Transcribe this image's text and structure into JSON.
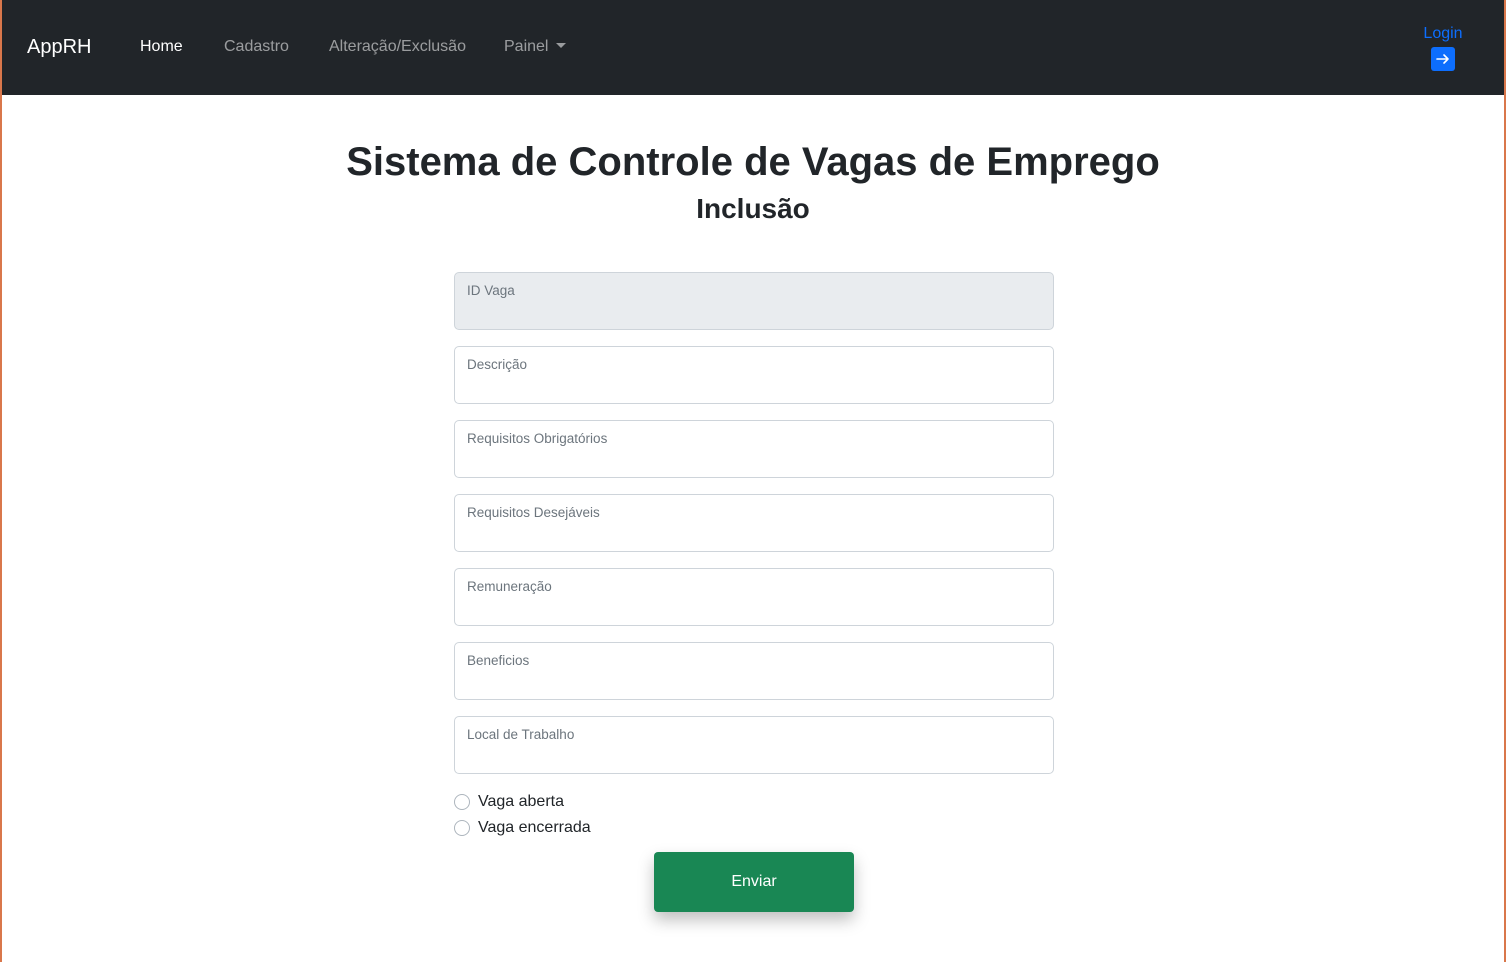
{
  "navbar": {
    "brand": "AppRH",
    "links": [
      {
        "label": "Home",
        "active": true
      },
      {
        "label": "Cadastro",
        "active": false
      },
      {
        "label": "Alteração/Exclusão",
        "active": false
      },
      {
        "label": "Painel",
        "active": false
      }
    ],
    "login_label": "Login",
    "login_icon": "arrow-right-square-icon",
    "accent_color": "#0d6efd"
  },
  "page": {
    "title": "Sistema de Controle de Vagas de Emprego",
    "subtitle": "Inclusão"
  },
  "form": {
    "fields": [
      {
        "label": "ID Vaga",
        "value": "",
        "disabled": true
      },
      {
        "label": "Descrição",
        "value": ""
      },
      {
        "label": "Requisitos Obrigatórios",
        "value": ""
      },
      {
        "label": "Requisitos Desejáveis",
        "value": ""
      },
      {
        "label": "Remuneração",
        "value": ""
      },
      {
        "label": "Beneficios",
        "value": ""
      },
      {
        "label": "Local de Trabalho",
        "value": ""
      }
    ],
    "radios": [
      {
        "label": "Vaga aberta",
        "checked": false
      },
      {
        "label": "Vaga encerrada",
        "checked": false
      }
    ],
    "submit_label": "Enviar",
    "submit_color": "#198754"
  }
}
